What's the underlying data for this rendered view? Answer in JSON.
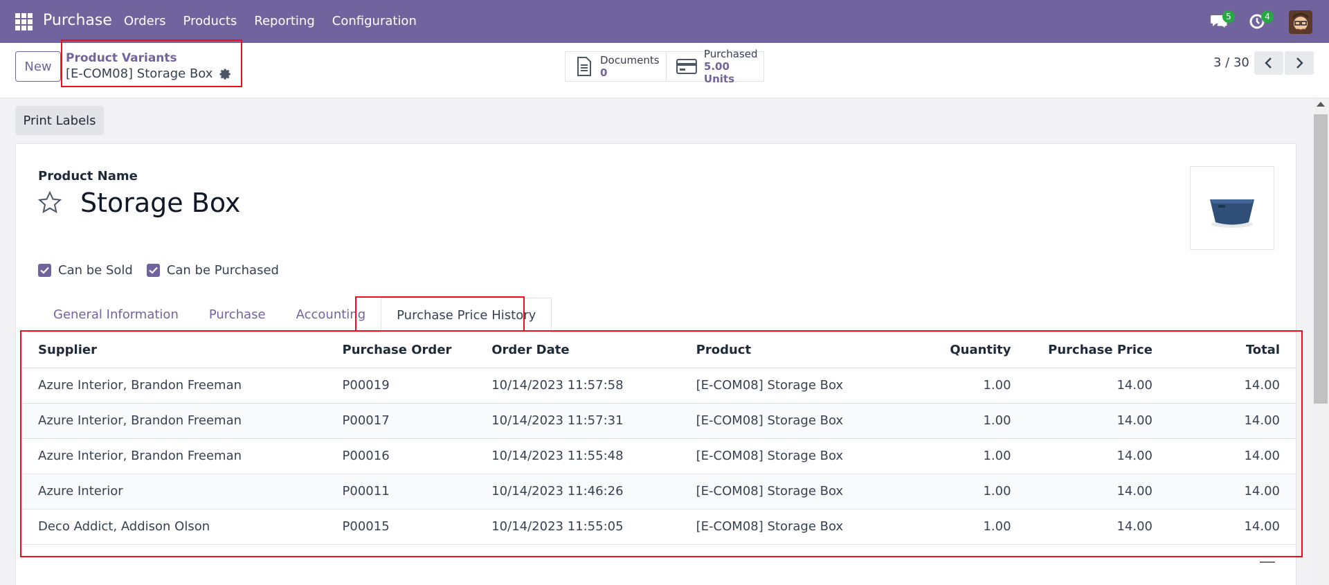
{
  "navbar": {
    "brand": "Purchase",
    "menu": [
      "Orders",
      "Products",
      "Reporting",
      "Configuration"
    ],
    "messages_count": "5",
    "activities_count": "4"
  },
  "control": {
    "new_label": "New",
    "breadcrumb_parent": "Product Variants",
    "breadcrumb_current": "[E-COM08] Storage Box",
    "documents_label": "Documents",
    "documents_value": "0",
    "purchased_label": "Purchased",
    "purchased_value": "5.00 Units",
    "pager": "3 / 30"
  },
  "actions": {
    "print_labels": "Print Labels"
  },
  "form": {
    "product_name_label": "Product Name",
    "product_name": "Storage Box",
    "can_be_sold": "Can be Sold",
    "can_be_purchased": "Can be Purchased"
  },
  "tabs": [
    "General Information",
    "Purchase",
    "Accounting",
    "Purchase Price History"
  ],
  "history": {
    "headers": [
      "Supplier",
      "Purchase Order",
      "Order Date",
      "Product",
      "Quantity",
      "Purchase Price",
      "Total"
    ],
    "rows": [
      [
        "Azure Interior, Brandon Freeman",
        "P00019",
        "10/14/2023 11:57:58",
        "[E-COM08] Storage Box",
        "1.00",
        "14.00",
        "14.00"
      ],
      [
        "Azure Interior, Brandon Freeman",
        "P00017",
        "10/14/2023 11:57:31",
        "[E-COM08] Storage Box",
        "1.00",
        "14.00",
        "14.00"
      ],
      [
        "Azure Interior, Brandon Freeman",
        "P00016",
        "10/14/2023 11:55:48",
        "[E-COM08] Storage Box",
        "1.00",
        "14.00",
        "14.00"
      ],
      [
        "Azure Interior",
        "P00011",
        "10/14/2023 11:46:26",
        "[E-COM08] Storage Box",
        "1.00",
        "14.00",
        "14.00"
      ],
      [
        "Deco Addict, Addison Olson",
        "P00015",
        "10/14/2023 11:55:05",
        "[E-COM08] Storage Box",
        "1.00",
        "14.00",
        "14.00"
      ]
    ]
  },
  "colors": {
    "navbar": "#71639e",
    "accent": "#71639e",
    "highlight": "#e8101b",
    "badge": "#28a745"
  }
}
